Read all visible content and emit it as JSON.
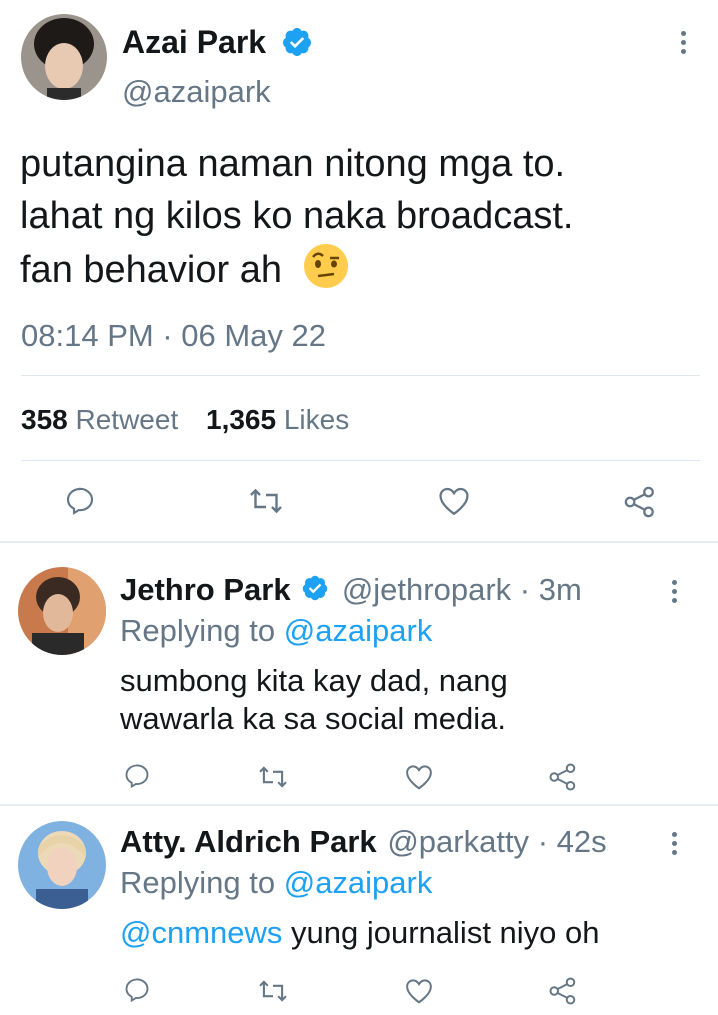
{
  "main_tweet": {
    "display_name": "Azai Park",
    "handle": "@azaipark",
    "text_lines": [
      "putangina naman nitong mga to.",
      "lahat ng kilos ko naka broadcast.",
      "fan behavior ah"
    ],
    "emoji": "🤨",
    "timestamp": "08:14 PM · 06 May 22",
    "retweet_count": "358",
    "retweet_label": "Retweet",
    "likes_count": "1,365",
    "likes_label": "Likes"
  },
  "replies": [
    {
      "display_name": "Jethro Park",
      "verified": true,
      "handle": "@jethropark",
      "time": "· 3m",
      "replying_prefix": "Replying to",
      "replying_to": "@azaipark",
      "text_lines": [
        "sumbong kita kay dad, nang",
        "wawarla ka sa social media."
      ]
    },
    {
      "display_name": "Atty. Aldrich Park",
      "verified": false,
      "handle": "@parkatty",
      "time": "· 42s",
      "replying_prefix": "Replying to",
      "replying_to": "@azaipark",
      "mention": "@cnmnews",
      "text_rest": "yung journalist niyo oh"
    }
  ],
  "colors": {
    "accent": "#1da1f2",
    "secondary_text": "#657786",
    "divider": "#e1e8ed"
  }
}
